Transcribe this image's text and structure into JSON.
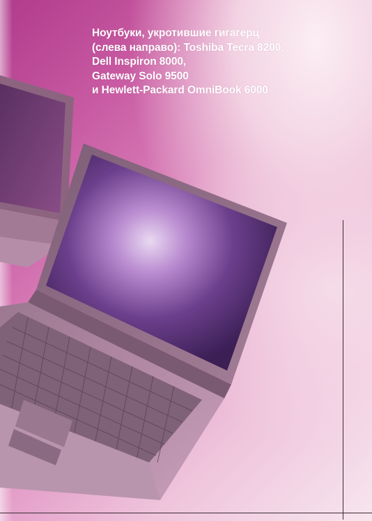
{
  "caption": {
    "lines": [
      "Ноутбуки, укротившие гигагерц",
      "(слева направо): Toshiba Tecra 8200,",
      "Dell Inspiron 8000,",
      "Gateway Solo 9500",
      "и Hewlett-Packard OmniBook 6000"
    ]
  },
  "colors": {
    "background_magenta": "#c85aa2",
    "background_light": "#f7e6ee",
    "caption_text": "#ffffff",
    "laptop_body": "#8f6f86",
    "screen": "#4a2a6a"
  }
}
